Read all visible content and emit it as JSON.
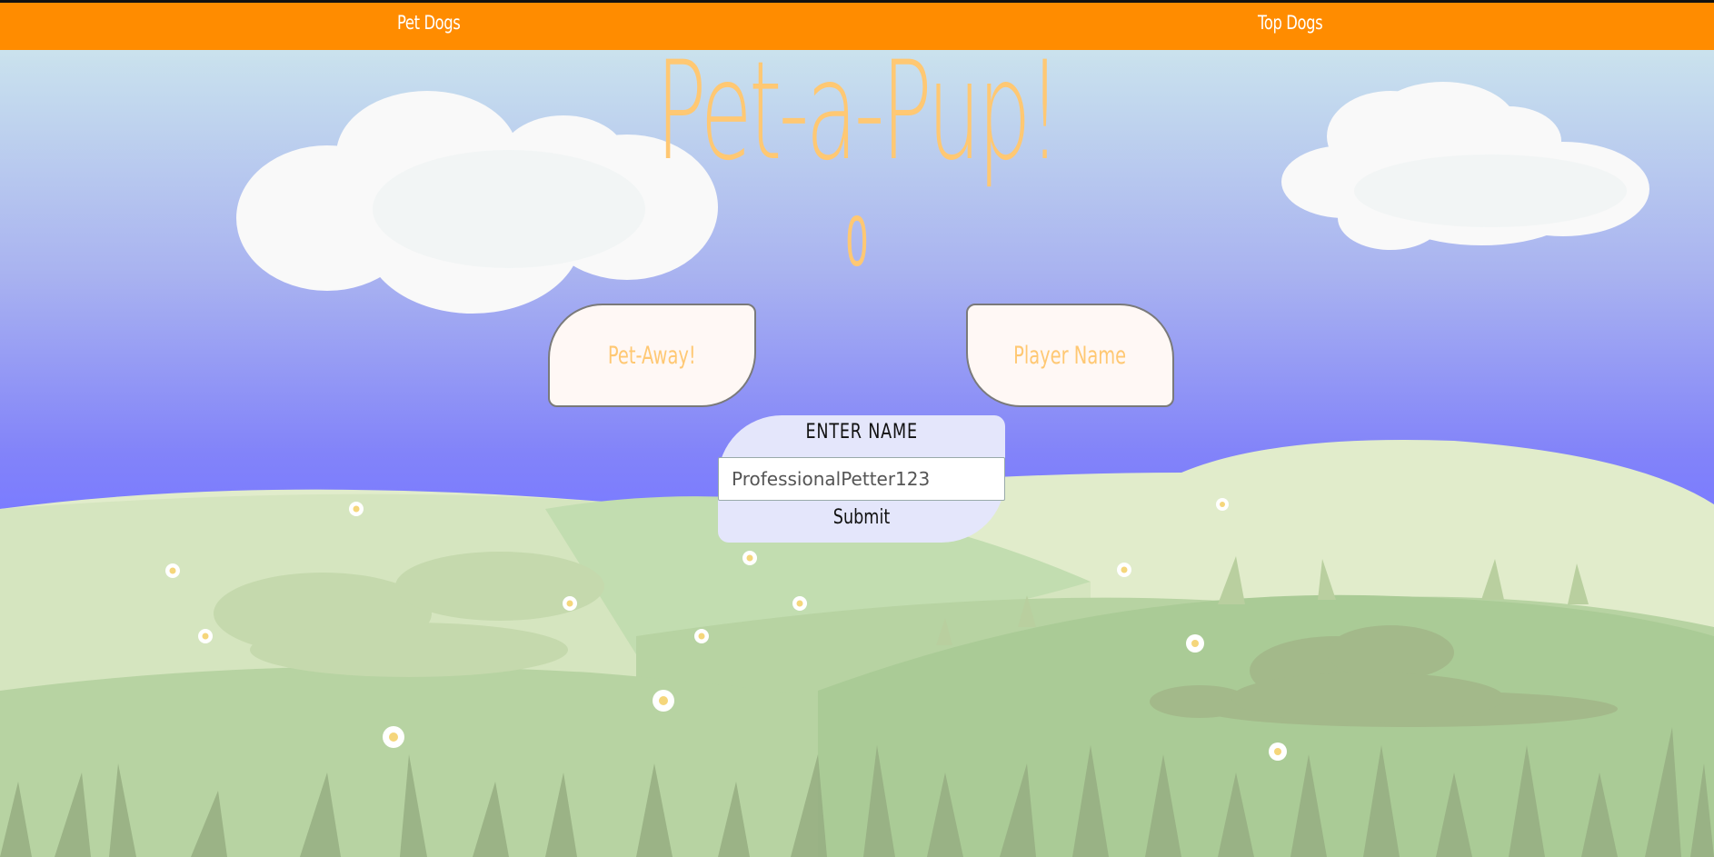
{
  "nav": {
    "pet_dogs": "Pet Dogs",
    "top_dogs": "Top Dogs"
  },
  "title": "Pet-a-Pup!",
  "score": "0",
  "buttons": {
    "pet_away": "Pet-Away!",
    "player_name": "Player Name"
  },
  "name_form": {
    "label": "ENTER NAME",
    "input_value": "ProfessionalPetter123",
    "submit_label": "Submit"
  },
  "colors": {
    "nav_bg": "#ff8c00",
    "accent_text": "#ffc873",
    "sky_top": "#d3ecec",
    "sky_bottom": "#7b7cff",
    "hill_light": "#dbe7c3",
    "hill_mid": "#b7d3a2",
    "form_bg": "#e4e6fb"
  },
  "icons": [
    "cloud-icon",
    "flower-icon",
    "grass-icon",
    "bush-icon"
  ]
}
